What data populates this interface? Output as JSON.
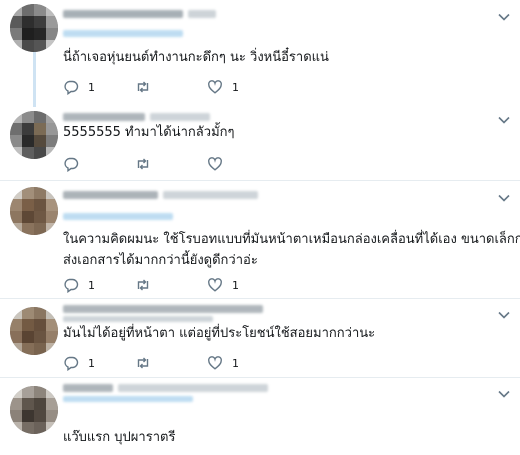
{
  "tweets": [
    {
      "text_lines": [
        "นี่ถ้าเจอหุ่นยนต์ทำงานกะดึกๆ นะ วิ่งหนีอี๋ราดแน่"
      ],
      "reply_count": "1",
      "like_count": "1"
    },
    {
      "text_lines": [
        "5555555 ทำมาได้น่ากลัวมั้กๆ"
      ],
      "reply_count": "",
      "like_count": ""
    },
    {
      "text_lines": [
        "ในความคิดผมนะ ใช้โรบอทแบบที่มันหน้าตาเหมือนกล่องเคลื่อนที่ได้เอง ขนาดเล็กกว่านี้",
        "ส่งเอกสารได้มากกว่านี้ยังดูดีกว่าอ่ะ"
      ],
      "reply_count": "1",
      "like_count": "1"
    },
    {
      "text_lines": [
        "มันไม่ได้อยู่ที่หน้าตา แต่อยู่ที่ประโยชน์ใช้สอยมากกว่านะ"
      ],
      "reply_count": "1",
      "like_count": "1"
    },
    {
      "text_lines": [
        "แว๊บแรก บุปผาราตรี"
      ],
      "reply_count": "",
      "like_count": ""
    }
  ],
  "icons": {
    "reply": "reply-icon",
    "retweet": "retweet-icon",
    "like": "like-icon",
    "menu": "chevron-down-icon"
  },
  "colors": {
    "icon_gray": "#657786",
    "thread_line": "#cfe3f3",
    "divider": "#e6ecf0"
  }
}
